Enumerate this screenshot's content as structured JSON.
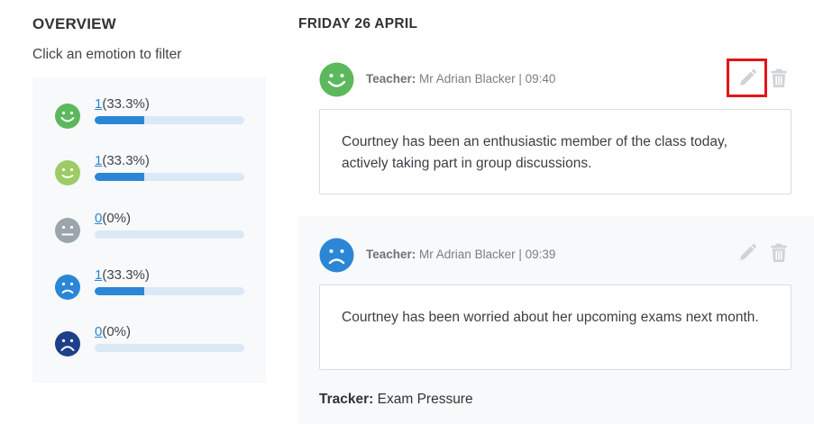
{
  "overview": {
    "title": "OVERVIEW",
    "subtitle": "Click an emotion to filter",
    "emotions": [
      {
        "icon": "very-happy-face-icon",
        "color": "#5cb85c",
        "count": "1",
        "percent": "(33.3%)",
        "fraction": 0.333
      },
      {
        "icon": "happy-face-icon",
        "color": "#9ccc65",
        "count": "1",
        "percent": "(33.3%)",
        "fraction": 0.333
      },
      {
        "icon": "neutral-face-icon",
        "color": "#9aa5ad",
        "count": "0",
        "percent": "(0%)",
        "fraction": 0
      },
      {
        "icon": "sad-face-icon",
        "color": "#2b86d6",
        "count": "1",
        "percent": "(33.3%)",
        "fraction": 0.333
      },
      {
        "icon": "very-sad-face-icon",
        "color": "#1e3f8a",
        "count": "0",
        "percent": "(0%)",
        "fraction": 0
      }
    ]
  },
  "timeline": {
    "date": "FRIDAY 26 APRIL",
    "entries": [
      {
        "icon": "very-happy-face-icon",
        "color": "#5cb85c",
        "teacher_label": "Teacher:",
        "teacher_info": "Mr Adrian Blacker | 09:40",
        "note": "Courtney has been an enthusiastic member of the class today, actively taking part in group discussions.",
        "edit_icon": "pencil-icon",
        "delete_icon": "trash-icon"
      },
      {
        "icon": "sad-face-icon",
        "color": "#2b86d6",
        "teacher_label": "Teacher:",
        "teacher_info": "Mr Adrian Blacker | 09:39",
        "note": "Courtney has been worried about her upcoming exams next month.",
        "edit_icon": "pencil-icon",
        "delete_icon": "trash-icon",
        "tracker_label": "Tracker:",
        "tracker_value": "Exam Pressure"
      }
    ]
  },
  "colors": {
    "accent": "#2b86d6",
    "highlight": "#e3151a",
    "icon_grey": "#cfd3d6"
  }
}
